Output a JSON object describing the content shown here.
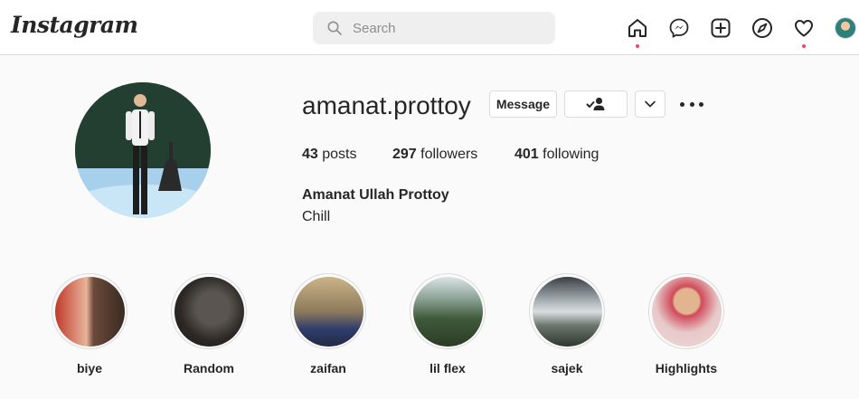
{
  "header": {
    "logo": "Instagram",
    "search_placeholder": "Search",
    "nav": [
      "home-icon",
      "messenger-icon",
      "new-post-icon",
      "explore-icon",
      "activity-heart-icon",
      "profile-avatar"
    ]
  },
  "profile": {
    "username": "amanat.prottoy",
    "message_label": "Message",
    "stats": {
      "posts_count": "43",
      "posts_label": "posts",
      "followers_count": "297",
      "followers_label": "followers",
      "following_count": "401",
      "following_label": "following"
    },
    "full_name": "Amanat Ullah Prottoy",
    "bio": "Chill"
  },
  "highlights": [
    {
      "label": "biye"
    },
    {
      "label": "Random"
    },
    {
      "label": "zaifan"
    },
    {
      "label": "lil flex"
    },
    {
      "label": "sajek"
    },
    {
      "label": "Highlights"
    }
  ],
  "colors": {
    "notification_dot": "#ed4956",
    "border": "#dbdbdb",
    "background": "#fafafa"
  }
}
